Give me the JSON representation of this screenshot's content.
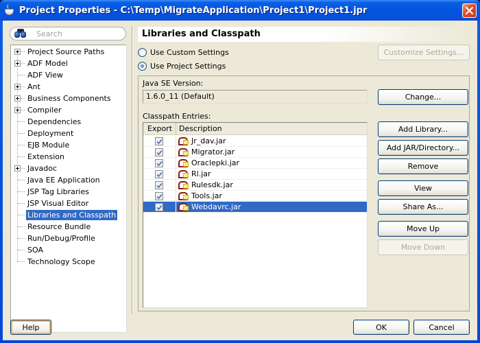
{
  "window": {
    "title": "Project Properties - C:\\Temp\\MigrateApplication\\Project1\\Project1.jpr",
    "close_icon": "close-icon",
    "app_icon": "java-cup-icon"
  },
  "search": {
    "placeholder": "Search",
    "icon": "binoculars-icon"
  },
  "nav": {
    "items": [
      {
        "label": "Project Source Paths",
        "expandable": true
      },
      {
        "label": "ADF Model",
        "expandable": true
      },
      {
        "label": "ADF View",
        "expandable": false
      },
      {
        "label": "Ant",
        "expandable": true
      },
      {
        "label": "Business Components",
        "expandable": true
      },
      {
        "label": "Compiler",
        "expandable": true
      },
      {
        "label": "Dependencies",
        "expandable": false
      },
      {
        "label": "Deployment",
        "expandable": false
      },
      {
        "label": "EJB Module",
        "expandable": false
      },
      {
        "label": "Extension",
        "expandable": false
      },
      {
        "label": "Javadoc",
        "expandable": true
      },
      {
        "label": "Java EE Application",
        "expandable": false
      },
      {
        "label": "JSP Tag Libraries",
        "expandable": false
      },
      {
        "label": "JSP Visual Editor",
        "expandable": false
      },
      {
        "label": "Libraries and Classpath",
        "expandable": false,
        "selected": true
      },
      {
        "label": "Resource Bundle",
        "expandable": false
      },
      {
        "label": "Run/Debug/Profile",
        "expandable": false
      },
      {
        "label": "SOA",
        "expandable": false
      },
      {
        "label": "Technology Scope",
        "expandable": false
      }
    ]
  },
  "panel": {
    "title": "Libraries and Classpath",
    "radio_custom": {
      "label": "Use Custom Settings",
      "checked": false
    },
    "radio_project": {
      "label": "Use Project Settings",
      "checked": true
    },
    "customize_button": "Customize Settings...",
    "java_version_label": "Java SE Version:",
    "java_version_value": "1.6.0_11 (Default)",
    "change_button": "Change...",
    "classpath_label": "Classpath Entries:",
    "table": {
      "columns": [
        "Export",
        "Description"
      ],
      "rows": [
        {
          "export": true,
          "description": "Jr_dav.jar"
        },
        {
          "export": true,
          "description": "Migrator.jar"
        },
        {
          "export": true,
          "description": "Oraclepki.jar"
        },
        {
          "export": true,
          "description": "Rl.jar"
        },
        {
          "export": true,
          "description": "Rulesdk.jar"
        },
        {
          "export": true,
          "description": "Tools.jar"
        },
        {
          "export": true,
          "description": "Webdavrc.jar",
          "selected": true
        }
      ]
    },
    "buttons": {
      "add_library": "Add Library...",
      "add_jar": "Add JAR/Directory...",
      "remove": "Remove",
      "view": "View",
      "share_as": "Share As...",
      "move_up": "Move Up",
      "move_down": "Move Down"
    }
  },
  "footer": {
    "help": "Help",
    "ok": "OK",
    "cancel": "Cancel"
  },
  "colors": {
    "selection": "#316ac5",
    "titlebar": "#0453dd",
    "dialog_bg": "#ece9d8"
  }
}
